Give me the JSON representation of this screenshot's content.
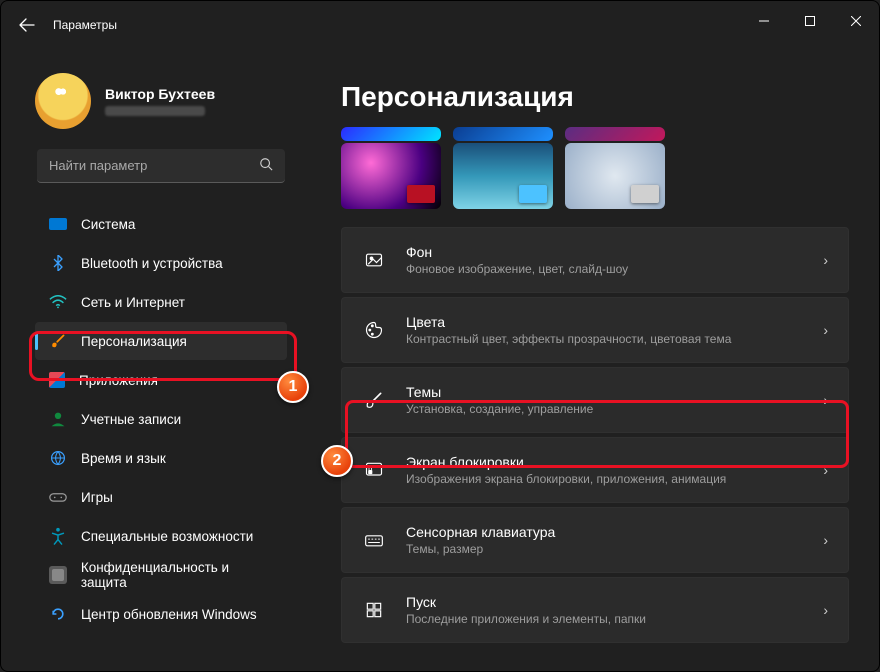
{
  "window": {
    "title": "Параметры"
  },
  "user": {
    "name": "Виктор Бухтеев"
  },
  "search": {
    "placeholder": "Найти параметр"
  },
  "nav": {
    "items": [
      {
        "id": "system",
        "label": "Система",
        "icon": "display"
      },
      {
        "id": "bt",
        "label": "Bluetooth и устройства",
        "icon": "bluetooth"
      },
      {
        "id": "net",
        "label": "Сеть и Интернет",
        "icon": "wifi"
      },
      {
        "id": "pers",
        "label": "Персонализация",
        "icon": "brush",
        "selected": true
      },
      {
        "id": "apps",
        "label": "Приложения",
        "icon": "grid"
      },
      {
        "id": "acct",
        "label": "Учетные записи",
        "icon": "user"
      },
      {
        "id": "time",
        "label": "Время и язык",
        "icon": "globe"
      },
      {
        "id": "games",
        "label": "Игры",
        "icon": "gamepad"
      },
      {
        "id": "access",
        "label": "Специальные возможности",
        "icon": "accessibility"
      },
      {
        "id": "priv",
        "label": "Конфиденциальность и защита",
        "icon": "shield"
      },
      {
        "id": "update",
        "label": "Центр обновления Windows",
        "icon": "update"
      }
    ]
  },
  "page": {
    "title": "Персонализация"
  },
  "cards": [
    {
      "id": "background",
      "title": "Фон",
      "sub": "Фоновое изображение, цвет, слайд-шоу"
    },
    {
      "id": "colors",
      "title": "Цвета",
      "sub": "Контрастный цвет, эффекты прозрачности, цветовая тема"
    },
    {
      "id": "themes",
      "title": "Темы",
      "sub": "Установка, создание, управление"
    },
    {
      "id": "lock",
      "title": "Экран блокировки",
      "sub": "Изображения экрана блокировки, приложения, анимация"
    },
    {
      "id": "touchkb",
      "title": "Сенсорная клавиатура",
      "sub": "Темы, размер"
    },
    {
      "id": "start",
      "title": "Пуск",
      "sub": "Последние приложения и элементы, папки"
    }
  ],
  "annotations": {
    "1": "1",
    "2": "2"
  }
}
